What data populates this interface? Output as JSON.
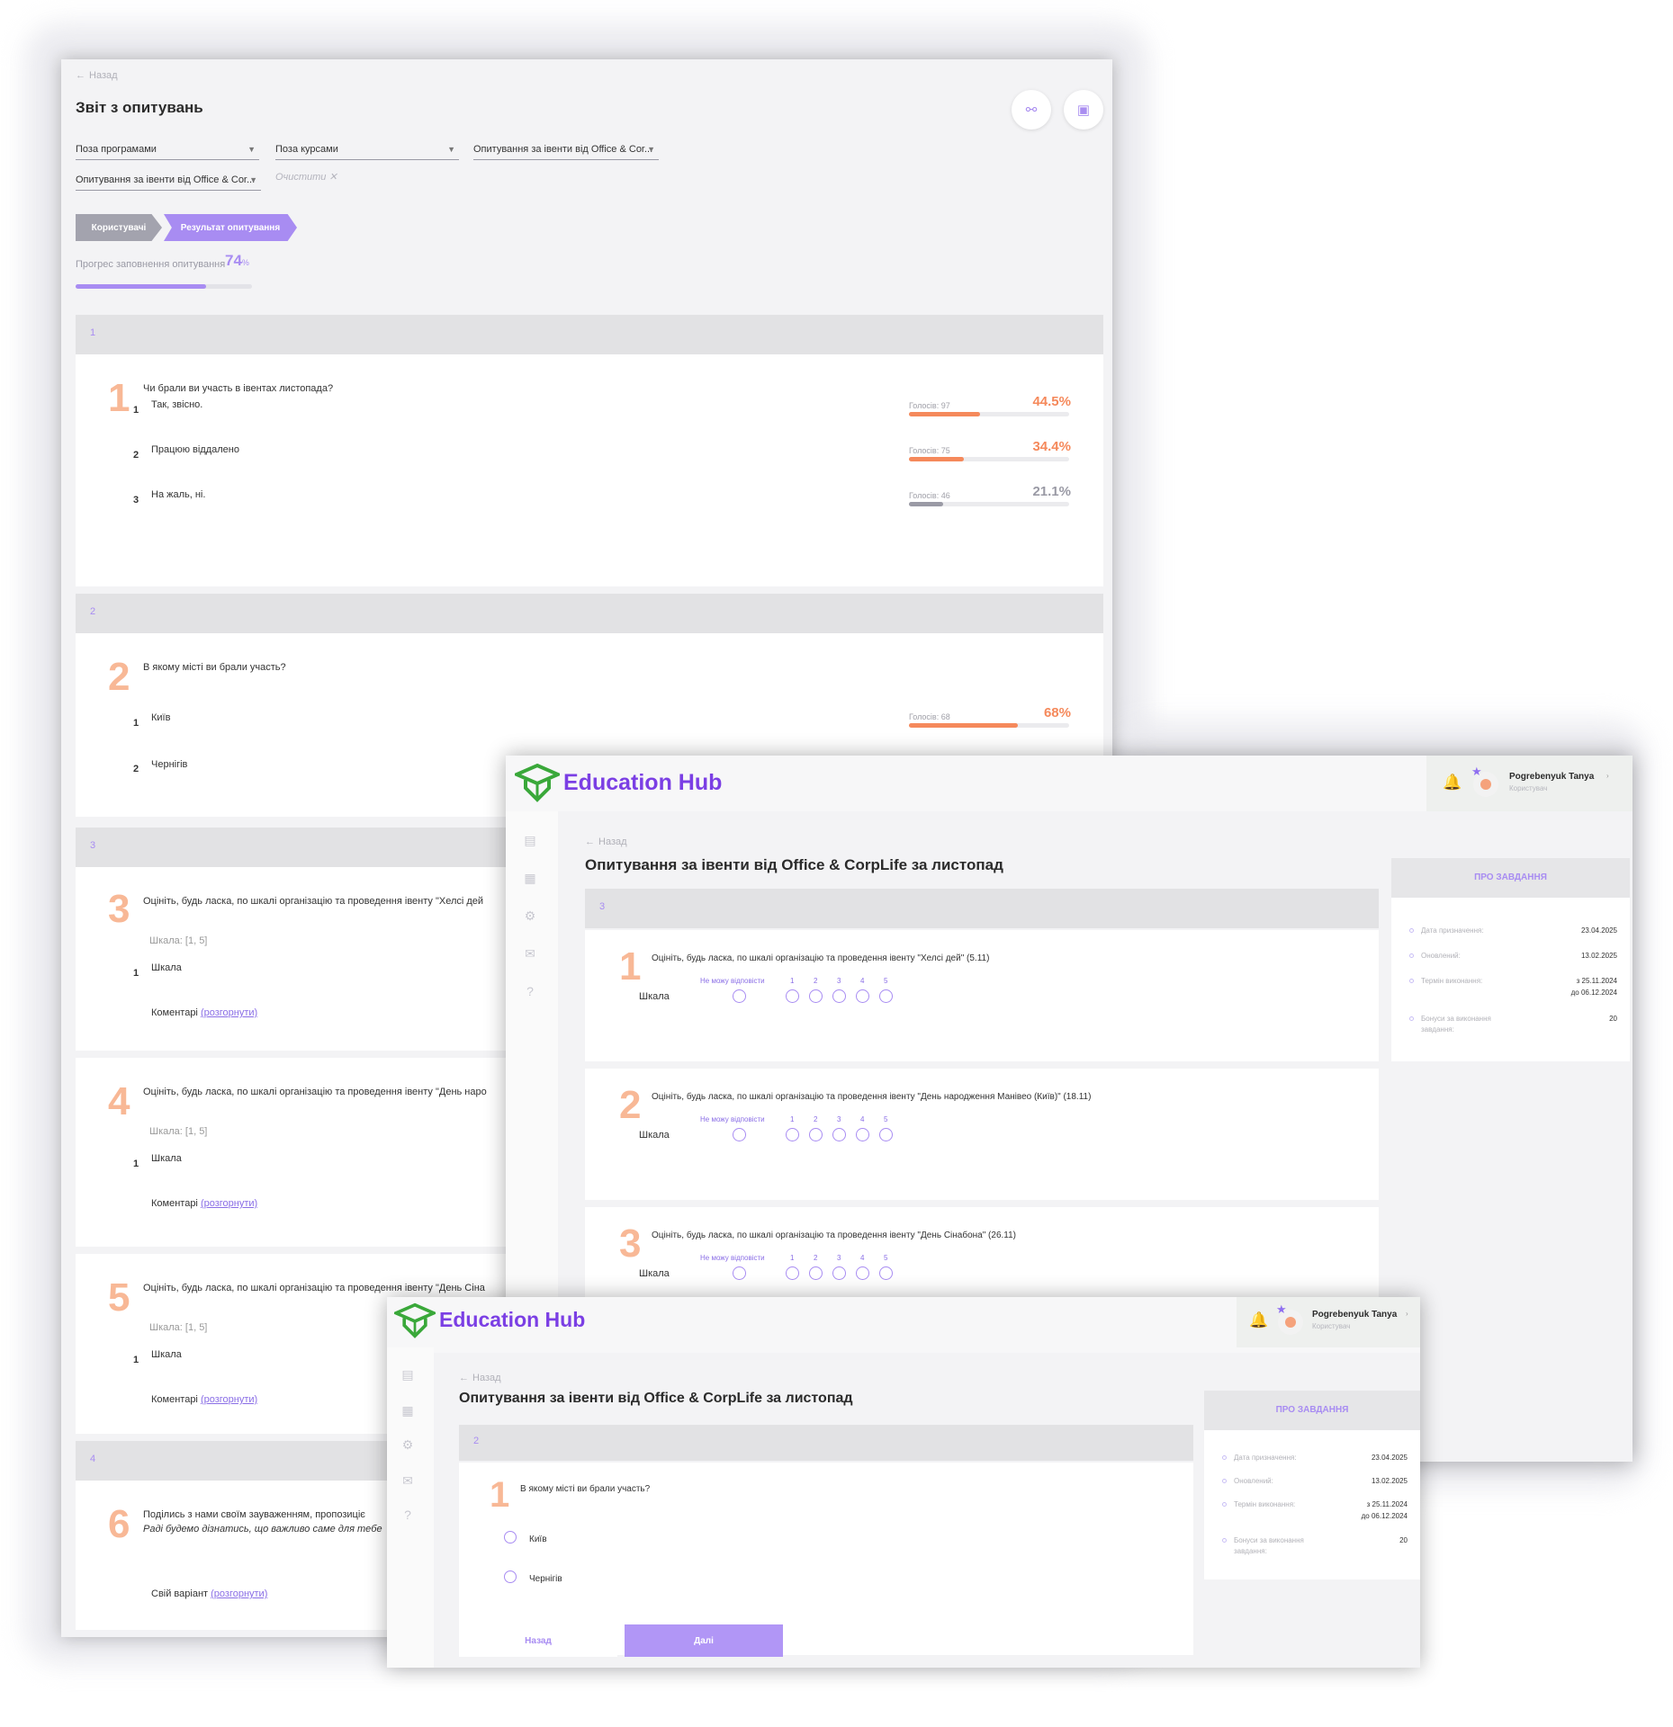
{
  "report": {
    "back": "Назад",
    "title": "Звіт з опитувань",
    "filters": {
      "program": "Поза програмами",
      "course": "Поза курсами",
      "survey1": "Опитування за івенти від Office & Cor...",
      "survey2": "Опитування за івенти від Office & Cor...",
      "clear": "Очистити"
    },
    "steps": {
      "users": "Користувачі",
      "result": "Результат опитування"
    },
    "progress": {
      "label": "Прогрес заповнення опитування",
      "value": "74",
      "unit": "%",
      "fraction": 0.74
    },
    "sections": [
      "1",
      "2",
      "3",
      "4"
    ],
    "q1": {
      "num": "1",
      "text": "Чи брали ви участь в івентах листопада?",
      "options": [
        {
          "num": "1",
          "text": "Так, звісно.",
          "votes": "Голосів: 97",
          "pct": "44.5%",
          "fraction": 0.445,
          "color": "#f5895b"
        },
        {
          "num": "2",
          "text": "Працюю віддалено",
          "votes": "Голосів: 75",
          "pct": "34.4%",
          "fraction": 0.344,
          "color": "#f5895b"
        },
        {
          "num": "3",
          "text": "На жаль, ні.",
          "votes": "Голосів: 46",
          "pct": "21.1%",
          "fraction": 0.211,
          "color": "#9a9aa5"
        }
      ]
    },
    "q2": {
      "num": "2",
      "text": "В якому місті ви брали участь?",
      "options": [
        {
          "num": "1",
          "text": "Київ",
          "votes": "Голосів: 68",
          "pct": "68%",
          "fraction": 0.68,
          "color": "#f5895b"
        },
        {
          "num": "2",
          "text": "Чернігів"
        }
      ]
    },
    "q3": {
      "num": "3",
      "text": "Оцініть, будь ласка, по шкалі організацію та проведення івенту \"Хелсі дей",
      "scale": "Шкала: [1, 5]",
      "opt_num": "1",
      "opt": "Шкала",
      "comment": "Коментарі",
      "expand": "(розгорнути)"
    },
    "q4": {
      "num": "4",
      "text": "Оцініть, будь ласка, по шкалі організацію та проведення івенту \"День наро",
      "scale": "Шкала: [1, 5]",
      "opt_num": "1",
      "opt": "Шкала",
      "comment": "Коментарі",
      "expand": "(розгорнути)"
    },
    "q5": {
      "num": "5",
      "text": "Оцініть, будь ласка, по шкалі організацію та проведення івенту \"День Сіна",
      "scale": "Шкала: [1, 5]",
      "opt_num": "1",
      "opt": "Шкала",
      "comment": "Коментарі",
      "expand": "(розгорнути)"
    },
    "q6": {
      "num": "6",
      "text1": "Поділись з нами своїм зауваженням, пропозиціє",
      "text2": "Раді будемо дізнатись, що важливо саме для тебе",
      "own": "Свій варіант",
      "expand": "(розгорнути)"
    }
  },
  "hub": {
    "brand": "Education Hub",
    "user": {
      "name": "Pogrebenyuk Tanya",
      "role": "Користувач"
    },
    "back": "Назад",
    "title": "Опитування за івенти від Office & CorpLife за листопад",
    "aside": {
      "head": "ПРО ЗАВДАННЯ",
      "assigned_label": "Дата призначення:",
      "assigned": "23.04.2025",
      "updated_label": "Оновлений:",
      "updated": "13.02.2025",
      "term_label": "Термін виконання:",
      "term_from": "з 25.11.2024",
      "term_to": "до 06.12.2024",
      "bonus_label1": "Бонуси за виконання",
      "bonus_label2": "завдання:",
      "bonus": "20"
    },
    "scale": {
      "cant": "Не можу відповісти",
      "marks": [
        "1",
        "2",
        "3",
        "4",
        "5"
      ],
      "label": "Шкала"
    }
  },
  "winB": {
    "section": "3",
    "questions": [
      {
        "num": "1",
        "text": "Оцініть, будь ласка, по шкалі організацію та проведення івенту \"Хелсі дей\"  (5.11)"
      },
      {
        "num": "2",
        "text": "Оцініть, будь ласка, по шкалі організацію та проведення івенту \"День народження Манівео (Київ)\" (18.11)"
      },
      {
        "num": "3",
        "text": "Оцініть, будь ласка, по шкалі організацію та проведення івенту \"День Сінабона\" (26.11)"
      }
    ]
  },
  "winC": {
    "section": "2",
    "q": {
      "num": "1",
      "text": "В якому місті ви брали участь?",
      "options": [
        "Київ",
        "Чернігів"
      ]
    },
    "back_btn": "Назад",
    "next_btn": "Далі"
  },
  "colors": {
    "accent": "#a88cf2",
    "orange": "#f5895b",
    "brand": "#7b3fe4",
    "logo_green": "#3aa83a"
  }
}
